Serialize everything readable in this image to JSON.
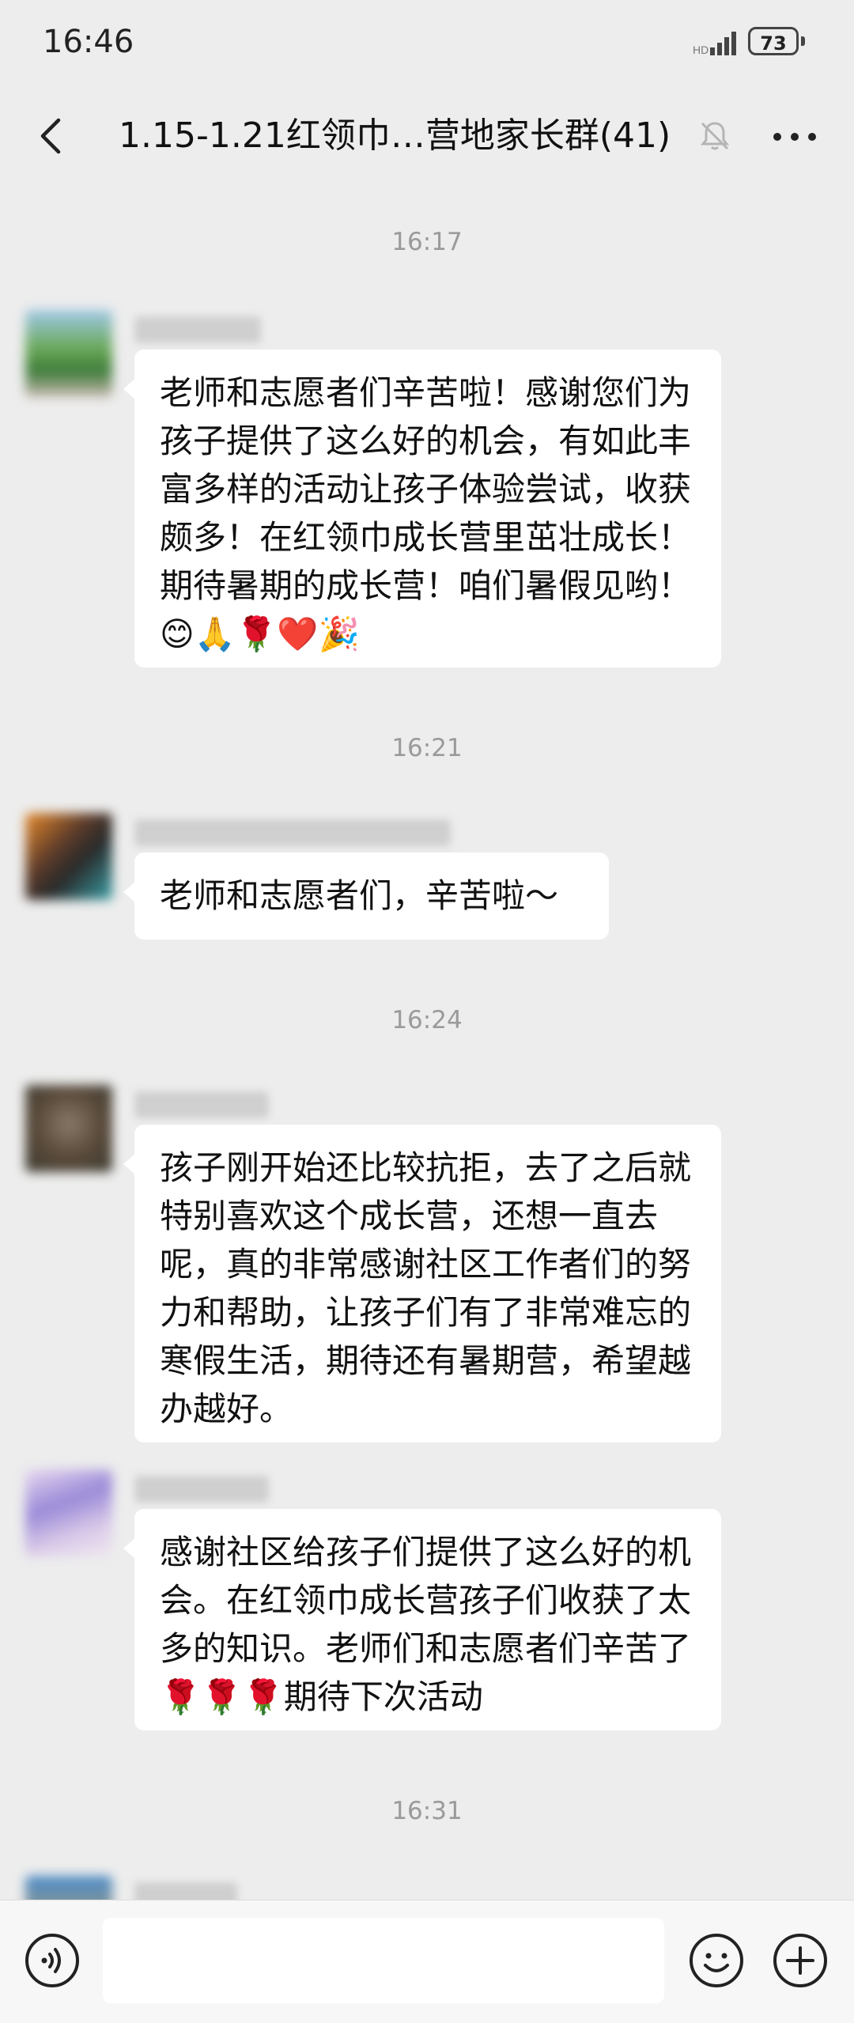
{
  "status_bar": {
    "time": "16:46",
    "battery": "73",
    "signal_icon": "signal-icon",
    "battery_icon": "battery-icon"
  },
  "nav": {
    "back_icon": "chevron-left-icon",
    "title": "1.15-1.21红领巾…营地家长群(41)",
    "mute_icon": "bell-off-icon",
    "more_icon": "more-horizontal-icon"
  },
  "messages": [
    {
      "timestamp": "16:17",
      "text": "老师和志愿者们辛苦啦！感谢您们为孩子提供了这么好的机会，有如此丰富多样的活动让孩子体验尝试，收获颇多！在红领巾成长营里茁壮成长！期待暑期的成长营！咱们暑假见哟！😊🙏🌹❤️🎉"
    },
    {
      "timestamp": "16:21",
      "text": "老师和志愿者们，辛苦啦～"
    },
    {
      "timestamp": "16:24",
      "text": "孩子刚开始还比较抗拒，去了之后就特别喜欢这个成长营，还想一直去呢，真的非常感谢社区工作者们的努力和帮助，让孩子们有了非常难忘的寒假生活，期待还有暑期营，希望越办越好。"
    },
    {
      "text": "感谢社区给孩子们提供了这么好的机会。在红领巾成长营孩子们收获了太多的知识。老师们和志愿者们辛苦了🌹🌹🌹期待下次活动"
    },
    {
      "timestamp": "16:31"
    }
  ],
  "input_bar": {
    "voice_icon": "voice-icon",
    "emoji_icon": "smiley-icon",
    "add_icon": "plus-circle-icon"
  },
  "colors": {
    "background": "#ededed",
    "bubble": "#ffffff",
    "timestamp": "#9a9a9a"
  }
}
